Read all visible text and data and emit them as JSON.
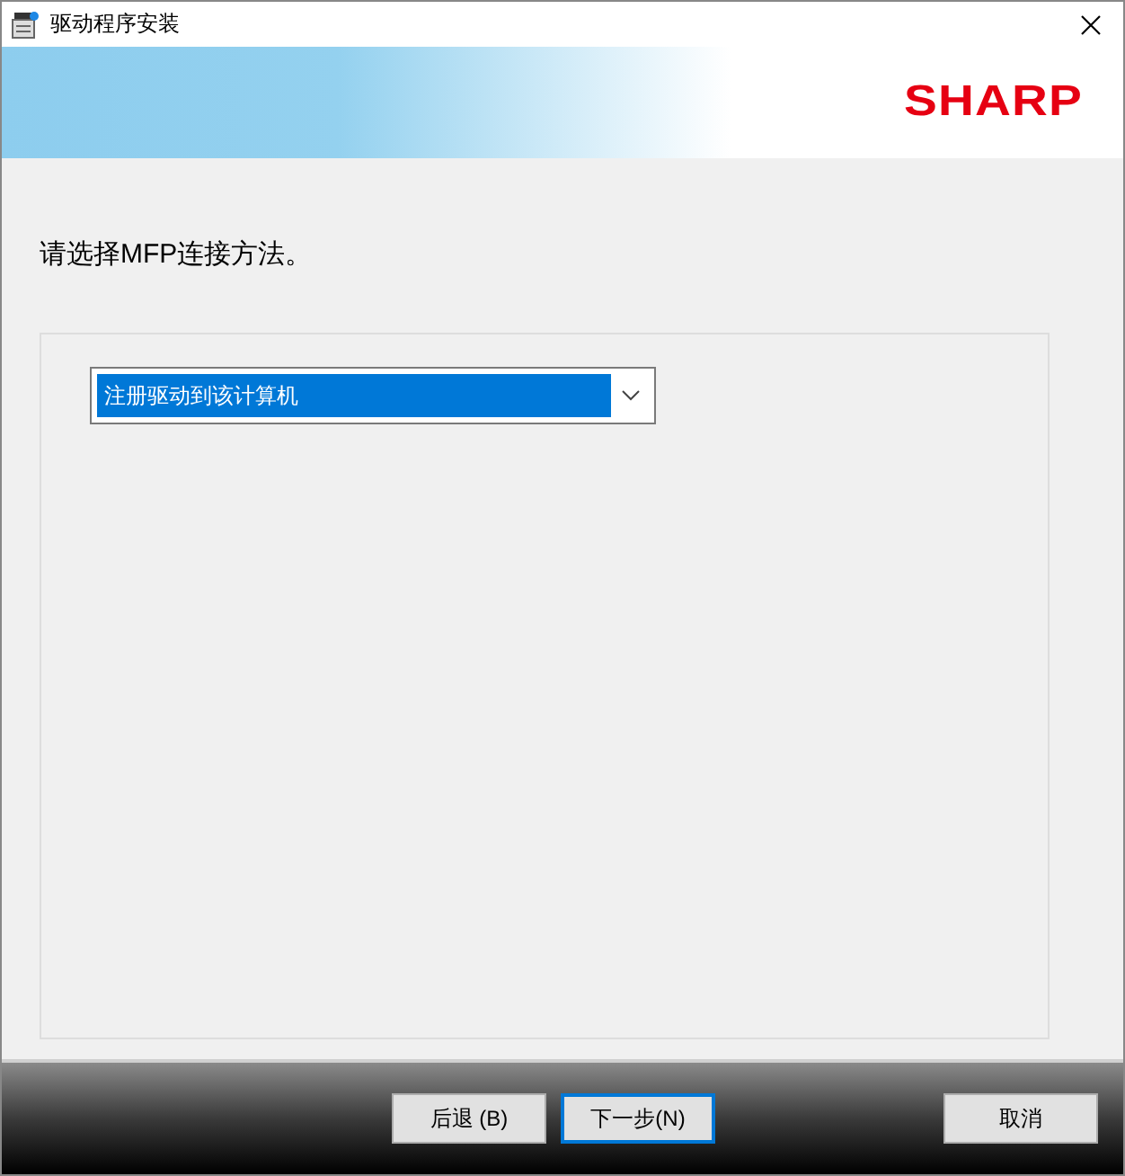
{
  "window": {
    "title": "驱动程序安装"
  },
  "banner": {
    "logo": "SHARP"
  },
  "prompt": "请选择MFP连接方法。",
  "dropdown": {
    "value": "注册驱动到该计算机",
    "highlighted": true
  },
  "buttons": [
    {
      "label": "后退 (B)",
      "focused": false
    },
    {
      "label": "下一步(N)",
      "focused": true
    },
    {
      "label": "取消",
      "focused": false
    }
  ]
}
